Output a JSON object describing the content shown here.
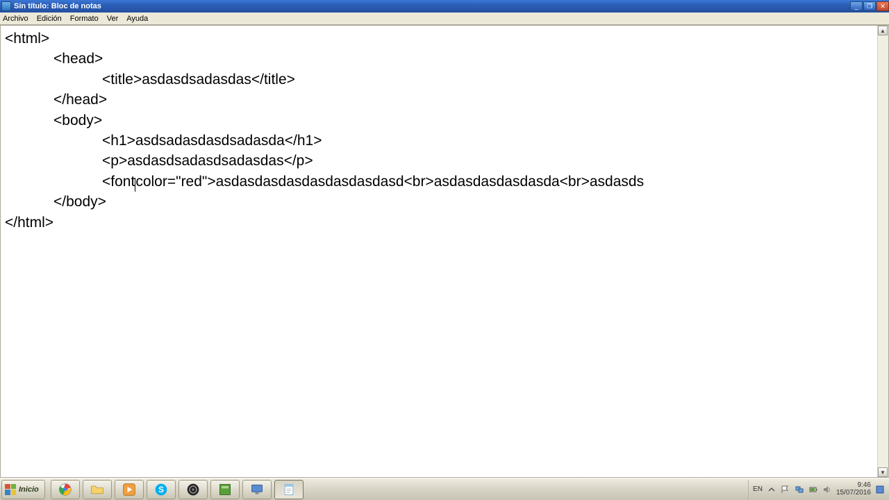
{
  "titlebar": {
    "title": "Sin título: Bloc de notas"
  },
  "menubar": {
    "items": [
      "Archivo",
      "Edición",
      "Formato",
      "Ver",
      "Ayuda"
    ]
  },
  "editor": {
    "lines": [
      "<html>",
      "            <head>",
      "                        <title>asdasdsadasdas</title>",
      "            </head>",
      "            <body>",
      "                        <h1>asdsadasdasdsadasda</h1>",
      "                        <p>asdasdsadasdsadasdas</p>",
      "                        <font|color=\"red\">asdasdasdasdasdasdasdasd<br>asdasdasdasdasda<br>asdasds",
      "            </body>",
      "</html>"
    ]
  },
  "taskbar": {
    "start": "Inicio",
    "lang": "EN",
    "time": "9:46",
    "date": "15/07/2016"
  }
}
